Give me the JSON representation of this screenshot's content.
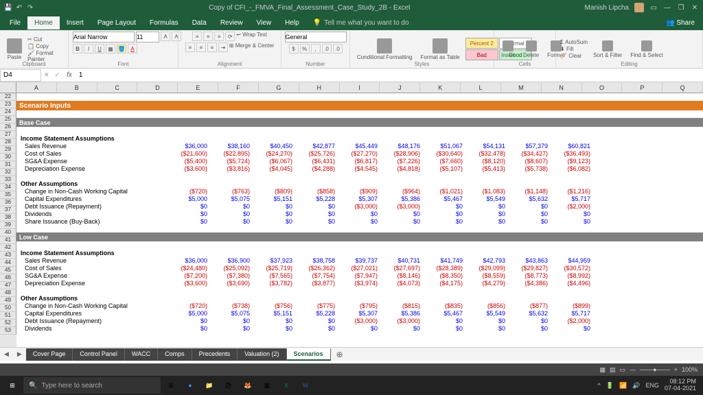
{
  "window": {
    "title": "Copy of CFI_-_FMVA_Final_Assessment_Case_Study_2B - Excel",
    "user": "Manish Lipcha"
  },
  "ribbon_tabs": [
    "File",
    "Home",
    "Insert",
    "Page Layout",
    "Formulas",
    "Data",
    "Review",
    "View",
    "Help"
  ],
  "tell_me": "Tell me what you want to do",
  "share": "Share",
  "ribbon": {
    "clipboard": {
      "label": "Clipboard",
      "paste": "Paste",
      "cut": "Cut",
      "copy": "Copy",
      "painter": "Format Painter"
    },
    "font": {
      "label": "Font",
      "font_name": "Arial Narrow",
      "font_size": "11"
    },
    "alignment": {
      "label": "Alignment",
      "wrap": "Wrap Text",
      "merge": "Merge & Center"
    },
    "number": {
      "label": "Number",
      "format": "General"
    },
    "styles": {
      "label": "Styles",
      "cond": "Conditional Formatting",
      "table": "Format as Table",
      "percent2": "Percent 2",
      "normal": "Normal",
      "bad": "Bad",
      "good": "Good"
    },
    "cells": {
      "label": "Cells",
      "insert": "Insert",
      "delete": "Delete",
      "format": "Format"
    },
    "editing": {
      "label": "Editing",
      "autosum": "AutoSum",
      "fill": "Fill",
      "clear": "Clear",
      "sort": "Sort & Filter",
      "find": "Find & Select"
    }
  },
  "formula_bar": {
    "name_box": "D4",
    "formula": "1"
  },
  "columns": [
    "A",
    "B",
    "C",
    "D",
    "E",
    "F",
    "G",
    "H",
    "I",
    "J",
    "K",
    "L",
    "M",
    "N",
    "O",
    "P",
    "Q"
  ],
  "rows": [
    "22",
    "23",
    "24",
    "25",
    "26",
    "27",
    "28",
    "29",
    "30",
    "31",
    "32",
    "33",
    "34",
    "35",
    "36",
    "37",
    "38",
    "39",
    "40",
    "41",
    "42",
    "43",
    "44",
    "45",
    "46",
    "47",
    "48",
    "49",
    "50",
    "51",
    "52",
    "53"
  ],
  "headings": {
    "scenario": "Scenario Inputs",
    "base": "Base Case",
    "low": "Low Case",
    "isa": "Income Statement Assumptions",
    "other": "Other Assumptions"
  },
  "labels": {
    "sales": "Sales Revenue",
    "cogs": "Cost of Sales",
    "sga": "SG&A Expense",
    "dep": "Depreciation Expense",
    "nwc": "Change in Non-Cash Working Capital",
    "capex": "Capital Expenditures",
    "debt": "Debt Issuance (Repayment)",
    "div": "Dividends",
    "share": "Share Issuance (Buy-Back)"
  },
  "base": {
    "sales": [
      "$36,000",
      "$38,160",
      "$40,450",
      "$42,877",
      "$45,449",
      "$48,176",
      "$51,067",
      "$54,131",
      "$57,379",
      "$60,821"
    ],
    "cogs": [
      "($21,600)",
      "($22,895)",
      "($24,270)",
      "($25,726)",
      "($27,270)",
      "($28,906)",
      "($30,640)",
      "($32,478)",
      "($34,427)",
      "($36,493)"
    ],
    "sga": [
      "($5,400)",
      "($5,724)",
      "($6,067)",
      "($6,431)",
      "($6,817)",
      "($7,226)",
      "($7,660)",
      "($8,120)",
      "($8,607)",
      "($9,123)"
    ],
    "dep": [
      "($3,600)",
      "($3,816)",
      "($4,045)",
      "($4,288)",
      "($4,545)",
      "($4,818)",
      "($5,107)",
      "($5,413)",
      "($5,738)",
      "($6,082)"
    ],
    "nwc": [
      "($720)",
      "($763)",
      "($809)",
      "($858)",
      "($909)",
      "($964)",
      "($1,021)",
      "($1,083)",
      "($1,148)",
      "($1,216)"
    ],
    "capex": [
      "$5,000",
      "$5,075",
      "$5,151",
      "$5,228",
      "$5,307",
      "$5,386",
      "$5,467",
      "$5,549",
      "$5,632",
      "$5,717"
    ],
    "debt": [
      "$0",
      "$0",
      "$0",
      "$0",
      "($3,000)",
      "($3,000)",
      "$0",
      "$0",
      "$0",
      "($2,000)"
    ],
    "div": [
      "$0",
      "$0",
      "$0",
      "$0",
      "$0",
      "$0",
      "$0",
      "$0",
      "$0",
      "$0"
    ],
    "share_bb": [
      "$0",
      "$0",
      "$0",
      "$0",
      "$0",
      "$0",
      "$0",
      "$0",
      "$0",
      "$0"
    ]
  },
  "low": {
    "sales": [
      "$36,000",
      "$36,900",
      "$37,923",
      "$38,758",
      "$39,737",
      "$40,731",
      "$41,749",
      "$42,793",
      "$43,863",
      "$44,959"
    ],
    "cogs": [
      "($24,480)",
      "($25,092)",
      "($25,719)",
      "($26,362)",
      "($27,021)",
      "($27,697)",
      "($28,389)",
      "($29,099)",
      "($29,827)",
      "($30,572)"
    ],
    "sga": [
      "($7,200)",
      "($7,380)",
      "($7,565)",
      "($7,754)",
      "($7,947)",
      "($8,146)",
      "($8,350)",
      "($8,559)",
      "($8,773)",
      "($8,992)"
    ],
    "dep": [
      "($3,600)",
      "($3,690)",
      "($3,782)",
      "($3,877)",
      "($3,974)",
      "($4,073)",
      "($4,175)",
      "($4,279)",
      "($4,386)",
      "($4,496)"
    ],
    "nwc": [
      "($720)",
      "($738)",
      "($756)",
      "($775)",
      "($795)",
      "($815)",
      "($835)",
      "($856)",
      "($877)",
      "($899)"
    ],
    "capex": [
      "$5,000",
      "$5,075",
      "$5,151",
      "$5,228",
      "$5,307",
      "$5,386",
      "$5,467",
      "$5,549",
      "$5,632",
      "$5,717"
    ],
    "debt": [
      "$0",
      "$0",
      "$0",
      "$0",
      "($3,000)",
      "($3,000)",
      "$0",
      "$0",
      "$0",
      "($2,000)"
    ],
    "div": [
      "$0",
      "$0",
      "$0",
      "$0",
      "$0",
      "$0",
      "$0",
      "$0",
      "$0",
      "$0"
    ]
  },
  "sheet_tabs": [
    "Cover Page",
    "Control Panel",
    "WACC",
    "Comps",
    "Precedents",
    "Valuation (2)",
    "Scenarios"
  ],
  "statusbar": {
    "zoom": "100%"
  },
  "taskbar": {
    "search": "Type here to search",
    "time": "08:12 PM",
    "date": "07-04-2021",
    "lang": "ENG"
  }
}
